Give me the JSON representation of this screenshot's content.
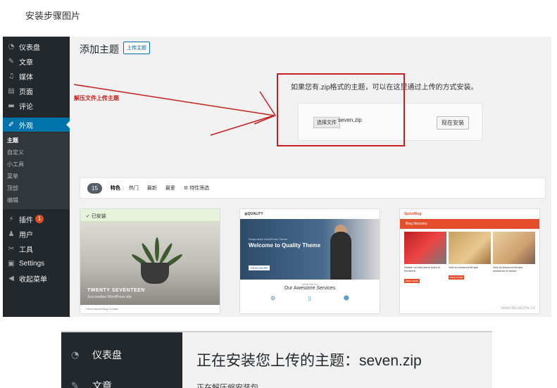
{
  "article": {
    "caption": "安装步骤图片"
  },
  "wp_sidebar": {
    "items": [
      {
        "icon": "dashboard-icon",
        "label": "仪表盘"
      },
      {
        "icon": "pin-icon",
        "label": "文章"
      },
      {
        "icon": "media-icon",
        "label": "媒体"
      },
      {
        "icon": "page-icon",
        "label": "页面"
      },
      {
        "icon": "comment-icon",
        "label": "评论"
      }
    ],
    "appearance": {
      "icon": "brush-icon",
      "label": "外观"
    },
    "appearance_submenu": [
      "主题",
      "自定义",
      "小工具",
      "菜单",
      "顶部",
      "编辑"
    ],
    "lower_items": [
      {
        "icon": "plugin-icon",
        "label": "插件",
        "badge": "1"
      },
      {
        "icon": "user-icon",
        "label": "用户"
      },
      {
        "icon": "wrench-icon",
        "label": "工具"
      },
      {
        "icon": "settings-icon",
        "label": "Settings"
      },
      {
        "icon": "collapse-icon",
        "label": "收起菜单"
      }
    ]
  },
  "main": {
    "title": "添加主题",
    "upload_button": "上传主题",
    "upload_hint": "如果您有.zip格式的主题，可以在这里通过上传的方式安装。",
    "choose_file": "选择文件",
    "file_name": "seven.zip",
    "install_now": "现在安装",
    "annotation": "解压文件上传主题"
  },
  "filter": {
    "count": "15",
    "tabs": [
      "特色",
      "热门",
      "最新",
      "最爱"
    ],
    "feature_filter": "特性筛选"
  },
  "themes": {
    "card1": {
      "installed": "已安装",
      "title": "TWENTY SEVENTEEN",
      "subtitle": "Just another WordPress site",
      "nav": "Home   About   Blog   Contact"
    },
    "card2": {
      "brand": "QUALITY",
      "kicker": "Responsive WordPress Theme",
      "headline": "Welcome to Quality Theme",
      "button": "READ MORE",
      "services_sub": "What We Do",
      "services_title": "Our Awesome Services"
    },
    "card3": {
      "brand": "SpiceBlog",
      "banner": "Blog Masonry",
      "posts": [
        "Nullam vel nisi lorem dolor in hendrerit.",
        "Sed do eiusmod tempor",
        "Sed do eiusmod tempor incididunt ut labore"
      ],
      "read_more": "READ MORE"
    },
    "watermark": "www.dhuanzhe.cn"
  },
  "shot2": {
    "sidebar": [
      {
        "icon": "dashboard-icon",
        "label": "仪表盘"
      },
      {
        "icon": "pin-icon",
        "label": "文章"
      }
    ],
    "title": "正在安装您上传的主题：seven.zip",
    "status": "正在解压缩安装包..."
  }
}
